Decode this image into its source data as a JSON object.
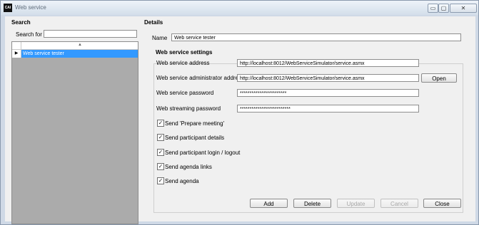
{
  "window": {
    "title": "Web service",
    "app_icon_text": "CAI",
    "controls": {
      "minimize": "▭",
      "maximize": "▢",
      "close": "✕"
    }
  },
  "search": {
    "section_title": "Search",
    "search_for_label": "Search for",
    "search_value": "",
    "sort_arrow": "▲",
    "rows": [
      {
        "marker": "▶",
        "name": "Web service tester"
      }
    ]
  },
  "details": {
    "section_title": "Details",
    "name_label": "Name",
    "name_value": "Web service tester",
    "settings_title": "Web service settings",
    "address_label": "Web service address",
    "address_value": "http://localhost:8012/WebServiceSimulator/service.asmx",
    "admin_address_label": "Web service administrator address",
    "admin_address_value": "http://localhost:8012/WebServiceSimulator/service.asmx",
    "open_label": "Open",
    "password_label": "Web service password",
    "password_value": "************************",
    "streaming_password_label": "Web streaming password",
    "streaming_password_value": "**************************",
    "checkboxes": [
      {
        "label": "Send 'Prepare meeting'",
        "checked": true
      },
      {
        "label": "Send participant details",
        "checked": true
      },
      {
        "label": "Send participant login / logout",
        "checked": true
      },
      {
        "label": "Send agenda links",
        "checked": true
      },
      {
        "label": "Send agenda",
        "checked": true
      }
    ],
    "check_mark": "✓"
  },
  "buttons": {
    "add": "Add",
    "delete": "Delete",
    "update": "Update",
    "cancel": "Cancel",
    "close": "Close"
  }
}
